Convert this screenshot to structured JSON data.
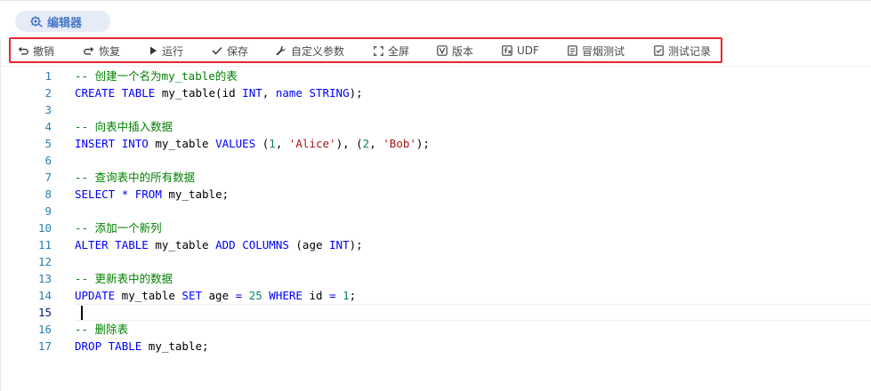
{
  "tab": {
    "label": "编辑器"
  },
  "toolbar": {
    "items": [
      {
        "id": "undo",
        "label": "撤销",
        "icon": "undo-icon"
      },
      {
        "id": "redo",
        "label": "恢复",
        "icon": "redo-icon"
      },
      {
        "id": "run",
        "label": "运行",
        "icon": "play-icon"
      },
      {
        "id": "save",
        "label": "保存",
        "icon": "check-icon"
      },
      {
        "id": "params",
        "label": "自定义参数",
        "icon": "wrench-icon"
      },
      {
        "id": "fullscreen",
        "label": "全屏",
        "icon": "fullscreen-icon"
      },
      {
        "id": "version",
        "label": "版本",
        "icon": "version-icon"
      },
      {
        "id": "udf",
        "label": "UDF",
        "icon": "function-icon"
      },
      {
        "id": "smoke",
        "label": "冒烟测试",
        "icon": "smoke-test-icon"
      },
      {
        "id": "records",
        "label": "测试记录",
        "icon": "test-record-icon"
      }
    ]
  },
  "editor": {
    "active_line": 15,
    "lines": [
      {
        "n": "1",
        "text": "-- 创建一个名为my_table的表"
      },
      {
        "n": "2",
        "text": "CREATE TABLE my_table(id INT, name STRING);"
      },
      {
        "n": "3",
        "text": ""
      },
      {
        "n": "4",
        "text": "-- 向表中插入数据"
      },
      {
        "n": "5",
        "text": "INSERT INTO my_table VALUES (1, 'Alice'), (2, 'Bob');"
      },
      {
        "n": "6",
        "text": ""
      },
      {
        "n": "7",
        "text": "-- 查询表中的所有数据"
      },
      {
        "n": "8",
        "text": "SELECT * FROM my_table;"
      },
      {
        "n": "9",
        "text": ""
      },
      {
        "n": "10",
        "text": "-- 添加一个新列"
      },
      {
        "n": "11",
        "text": "ALTER TABLE my_table ADD COLUMNS (age INT);"
      },
      {
        "n": "12",
        "text": ""
      },
      {
        "n": "13",
        "text": "-- 更新表中的数据"
      },
      {
        "n": "14",
        "text": "UPDATE my_table SET age = 25 WHERE id = 1;"
      },
      {
        "n": "15",
        "text": ""
      },
      {
        "n": "16",
        "text": "-- 删除表"
      },
      {
        "n": "17",
        "text": "DROP TABLE my_table;"
      }
    ]
  },
  "colors": {
    "tab_bg": "#e6ecf7",
    "tab_text": "#4a78c8",
    "highlight_border": "#e8262e",
    "line_number": "#2b7fb3",
    "comment": "#008000",
    "keyword": "#0000ff",
    "string": "#a31515",
    "number": "#098658"
  }
}
